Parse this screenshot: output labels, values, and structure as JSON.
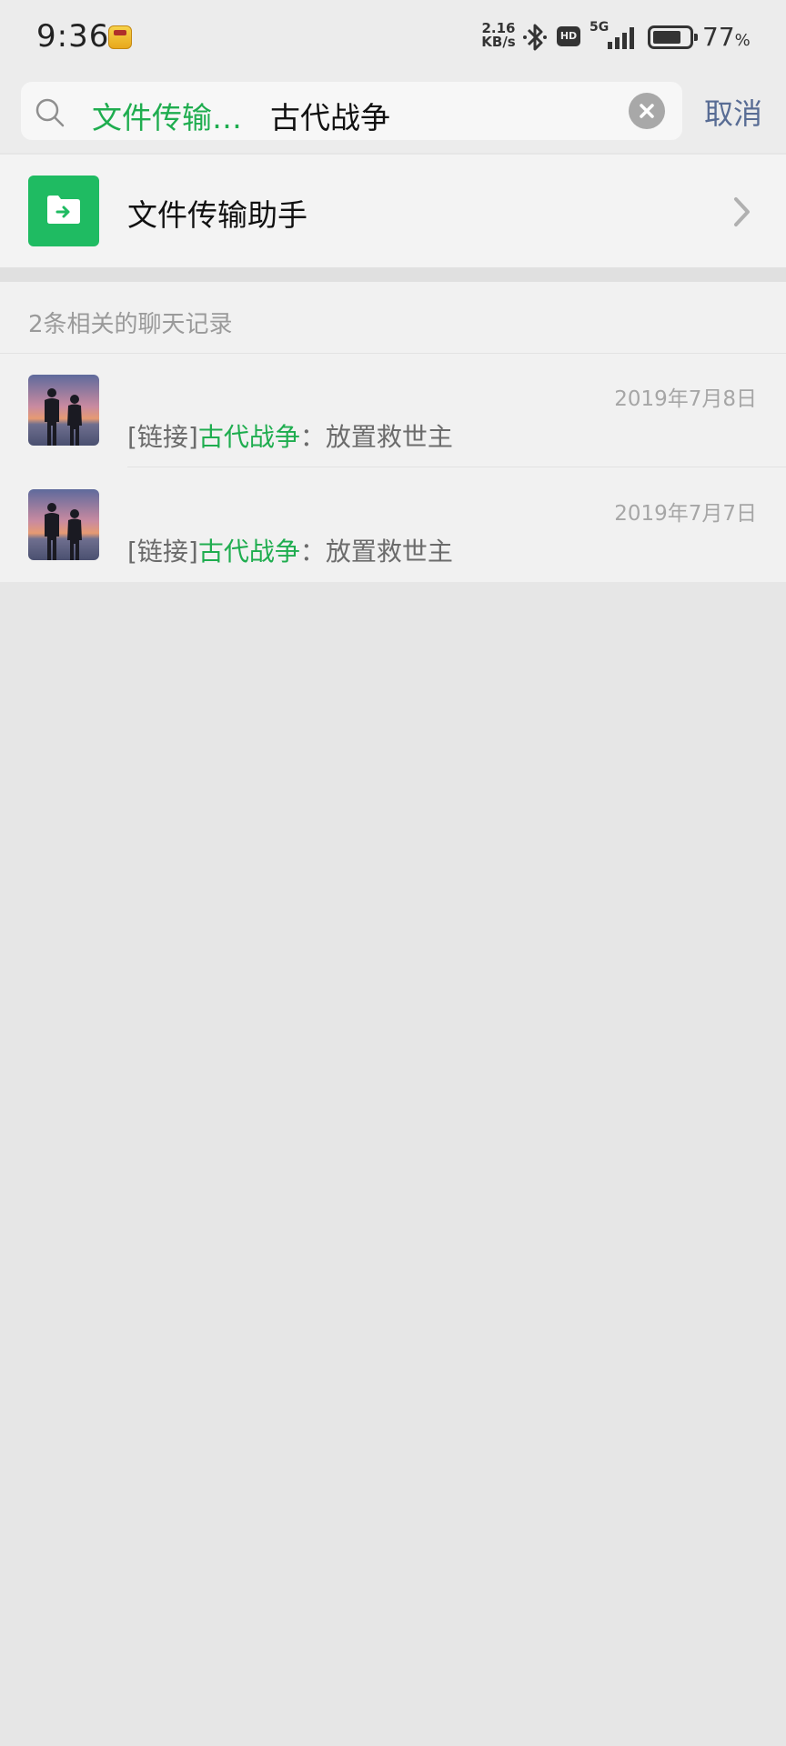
{
  "status_bar": {
    "time": "9:36",
    "net_speed_value": "2.16",
    "net_speed_unit": "KB/s",
    "hd_label": "HD",
    "network_type": "5G",
    "battery_value": "77",
    "battery_unit": "%"
  },
  "search": {
    "scope_tag": "文件传输…",
    "query": "古代战争",
    "cancel_label": "取消"
  },
  "contact": {
    "name": "文件传输助手",
    "avatar_color": "#1fbb62"
  },
  "chat_records": {
    "header": "2条相关的聊天记录",
    "items": [
      {
        "date": "2019年7月8日",
        "prefix": "[链接]",
        "highlight": "古代战争",
        "suffix": "：放置救世主"
      },
      {
        "date": "2019年7月7日",
        "prefix": "[链接]",
        "highlight": "古代战争",
        "suffix": "：放置救世主"
      }
    ]
  },
  "colors": {
    "accent_green": "#1fad4f",
    "cancel_blue": "#586c94",
    "background": "#e6e6e6"
  }
}
